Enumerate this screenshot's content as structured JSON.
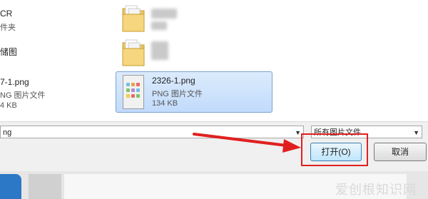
{
  "files": [
    {
      "name": "CR",
      "meta": "件夹"
    },
    {
      "name": "储图",
      "meta": ""
    },
    {
      "name": "7-1.png",
      "meta": "NG 图片文件",
      "size": "4 KB"
    }
  ],
  "selected_file": {
    "name": "2326-1.png",
    "type": "PNG 图片文件",
    "size": "134 KB"
  },
  "filename_field": {
    "value": "ng"
  },
  "filetype_select": {
    "value": "所有图片文件"
  },
  "buttons": {
    "open": "打开(O)",
    "cancel": "取消"
  },
  "watermark": {
    "text": "爱创根知识网"
  },
  "colors": {
    "annotation": "#e02020",
    "selection": "#c1dbfc"
  }
}
